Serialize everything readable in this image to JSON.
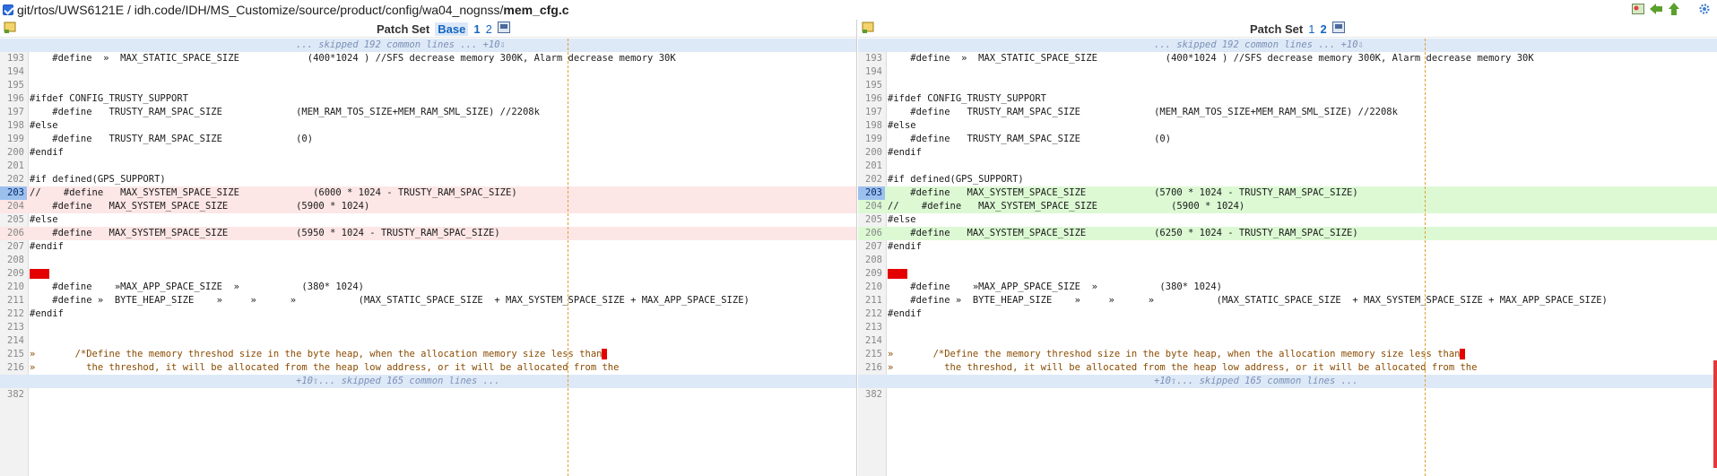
{
  "topbar": {
    "path_prefix": "git/rtos/UWS6121E / idh.code/IDH/MS_Customize/source/product/config/wa04_nognss/",
    "file_name": "mem_cfg.c",
    "tool_icons": [
      "image-icon",
      "arrow-left-icon",
      "arrow-up-icon",
      "gear-icon"
    ]
  },
  "left": {
    "patchset_label": "Patch Set",
    "patchsets": [
      "Base",
      "1",
      "2"
    ],
    "lines": [
      {
        "kind": "skip",
        "text": "... skipped 192 common lines ... +10⇩"
      },
      {
        "kind": "ctx",
        "n": "193",
        "text": "    #define  »  MAX_STATIC_SPACE_SIZE            (400*1024 ) //SFS decrease memory 300K, Alarm decrease memory 30K"
      },
      {
        "kind": "ctx",
        "n": "194",
        "text": ""
      },
      {
        "kind": "ctx",
        "n": "195",
        "text": ""
      },
      {
        "kind": "ctx",
        "n": "196",
        "text": "#ifdef CONFIG_TRUSTY_SUPPORT"
      },
      {
        "kind": "ctx",
        "n": "197",
        "text": "    #define   TRUSTY_RAM_SPAC_SIZE             (MEM_RAM_TOS_SIZE+MEM_RAM_SML_SIZE) //2208k"
      },
      {
        "kind": "ctx",
        "n": "198",
        "text": "#else"
      },
      {
        "kind": "ctx",
        "n": "199",
        "text": "    #define   TRUSTY_RAM_SPAC_SIZE             (0)"
      },
      {
        "kind": "ctx",
        "n": "200",
        "text": "#endif"
      },
      {
        "kind": "ctx",
        "n": "201",
        "text": ""
      },
      {
        "kind": "ctx",
        "n": "202",
        "text": "#if defined(GPS_SUPPORT)"
      },
      {
        "kind": "del",
        "n": "203",
        "text": "//    #define   MAX_SYSTEM_SPACE_SIZE             (6000 * 1024 - TRUSTY_RAM_SPAC_SIZE)"
      },
      {
        "kind": "del2",
        "n": "204",
        "text": "    #define   MAX_SYSTEM_SPACE_SIZE            (5900 * 1024)"
      },
      {
        "kind": "ctx",
        "n": "205",
        "text": "#else"
      },
      {
        "kind": "del2",
        "n": "206",
        "text": "    #define   MAX_SYSTEM_SPACE_SIZE            (5950 * 1024 - TRUSTY_RAM_SPAC_SIZE)"
      },
      {
        "kind": "ctx",
        "n": "207",
        "text": "#endif"
      },
      {
        "kind": "ctx",
        "n": "208",
        "text": ""
      },
      {
        "kind": "red",
        "n": "209",
        "text": ""
      },
      {
        "kind": "ctx",
        "n": "210",
        "text": "    #define    »MAX_APP_SPACE_SIZE  »           (380* 1024)"
      },
      {
        "kind": "ctx",
        "n": "211",
        "text": "    #define »  BYTE_HEAP_SIZE    »     »      »           (MAX_STATIC_SPACE_SIZE  + MAX_SYSTEM_SPACE_SIZE + MAX_APP_SPACE_SIZE)"
      },
      {
        "kind": "ctx",
        "n": "212",
        "text": "#endif"
      },
      {
        "kind": "ctx",
        "n": "213",
        "text": ""
      },
      {
        "kind": "ctx",
        "n": "214",
        "text": ""
      },
      {
        "kind": "cmt",
        "n": "215",
        "text": "»       /*Define the memory threshod size in the byte heap, when the allocation memory size less than"
      },
      {
        "kind": "cmt",
        "n": "216",
        "text": "»         the threshod, it will be allocated from the heap low address, or it will be allocated from the"
      },
      {
        "kind": "skip",
        "text": "+10⇧... skipped 165 common lines ..."
      },
      {
        "kind": "ctx",
        "n": "382",
        "text": ""
      }
    ]
  },
  "right": {
    "patchset_label": "Patch Set",
    "patchsets": [
      "1",
      "2"
    ],
    "lines": [
      {
        "kind": "skip",
        "text": "... skipped 192 common lines ... +10⇩"
      },
      {
        "kind": "ctx",
        "n": "193",
        "text": "    #define  »  MAX_STATIC_SPACE_SIZE            (400*1024 ) //SFS decrease memory 300K, Alarm decrease memory 30K"
      },
      {
        "kind": "ctx",
        "n": "194",
        "text": ""
      },
      {
        "kind": "ctx",
        "n": "195",
        "text": ""
      },
      {
        "kind": "ctx",
        "n": "196",
        "text": "#ifdef CONFIG_TRUSTY_SUPPORT"
      },
      {
        "kind": "ctx",
        "n": "197",
        "text": "    #define   TRUSTY_RAM_SPAC_SIZE             (MEM_RAM_TOS_SIZE+MEM_RAM_SML_SIZE) //2208k"
      },
      {
        "kind": "ctx",
        "n": "198",
        "text": "#else"
      },
      {
        "kind": "ctx",
        "n": "199",
        "text": "    #define   TRUSTY_RAM_SPAC_SIZE             (0)"
      },
      {
        "kind": "ctx",
        "n": "200",
        "text": "#endif"
      },
      {
        "kind": "ctx",
        "n": "201",
        "text": ""
      },
      {
        "kind": "ctx",
        "n": "202",
        "text": "#if defined(GPS_SUPPORT)"
      },
      {
        "kind": "add",
        "n": "203",
        "text": "    #define   MAX_SYSTEM_SPACE_SIZE            (5700 * 1024 - TRUSTY_RAM_SPAC_SIZE)"
      },
      {
        "kind": "add2",
        "n": "204",
        "text": "//    #define   MAX_SYSTEM_SPACE_SIZE             (5900 * 1024)"
      },
      {
        "kind": "ctx",
        "n": "205",
        "text": "#else"
      },
      {
        "kind": "add2",
        "n": "206",
        "text": "    #define   MAX_SYSTEM_SPACE_SIZE            (6250 * 1024 - TRUSTY_RAM_SPAC_SIZE)"
      },
      {
        "kind": "ctx",
        "n": "207",
        "text": "#endif"
      },
      {
        "kind": "ctx",
        "n": "208",
        "text": ""
      },
      {
        "kind": "red",
        "n": "209",
        "text": ""
      },
      {
        "kind": "ctx",
        "n": "210",
        "text": "    #define    »MAX_APP_SPACE_SIZE  »           (380* 1024)"
      },
      {
        "kind": "ctx",
        "n": "211",
        "text": "    #define »  BYTE_HEAP_SIZE    »     »      »           (MAX_STATIC_SPACE_SIZE  + MAX_SYSTEM_SPACE_SIZE + MAX_APP_SPACE_SIZE)"
      },
      {
        "kind": "ctx",
        "n": "212",
        "text": "#endif"
      },
      {
        "kind": "ctx",
        "n": "213",
        "text": ""
      },
      {
        "kind": "ctx",
        "n": "214",
        "text": ""
      },
      {
        "kind": "cmt",
        "n": "215",
        "text": "»       /*Define the memory threshod size in the byte heap, when the allocation memory size less than"
      },
      {
        "kind": "cmt",
        "n": "216",
        "text": "»         the threshod, it will be allocated from the heap low address, or it will be allocated from the"
      },
      {
        "kind": "skip",
        "text": "+10⇧... skipped 165 common lines ..."
      },
      {
        "kind": "ctx",
        "n": "382",
        "text": ""
      }
    ]
  },
  "colors": {
    "deleted": "#fde6e6",
    "added": "#dcf9d4",
    "skip": "#dde9f7",
    "gutter_selected": "#9cc0ee",
    "marker": "#e50000"
  }
}
